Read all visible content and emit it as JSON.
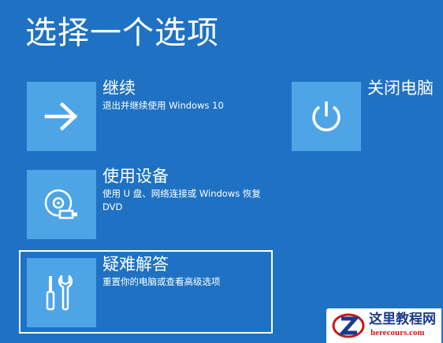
{
  "screen": {
    "title": "选择一个选项"
  },
  "options": {
    "continue": {
      "title": "继续",
      "description": "退出并继续使用 Windows 10",
      "icon": "arrow-right-icon"
    },
    "use_device": {
      "title": "使用设备",
      "description": "使用 U 盘、网络连接或 Windows 恢复 DVD",
      "icon": "disc-drive-icon"
    },
    "troubleshoot": {
      "title": "疑难解答",
      "description": "重置你的电脑或查看高级选项",
      "icon": "tools-icon",
      "selected": true
    },
    "shutdown": {
      "title": "关闭电脑",
      "icon": "power-icon"
    }
  },
  "watermark": {
    "brand": "这里教程网",
    "url": "herecours.com"
  },
  "colors": {
    "background": "#1f72c3",
    "tile": "#4ea5e6",
    "text": "#ffffff"
  }
}
